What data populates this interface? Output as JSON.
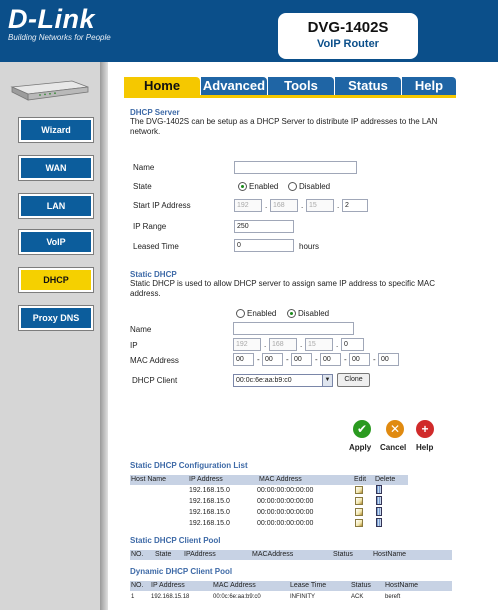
{
  "header": {
    "brand": "D-Link",
    "tagline": "Building Networks for People",
    "product_name": "DVG-1402S",
    "product_sub": "VoIP Router"
  },
  "sidebar": {
    "items": [
      {
        "label": "Wizard",
        "active": false
      },
      {
        "label": "WAN",
        "active": false
      },
      {
        "label": "LAN",
        "active": false
      },
      {
        "label": "VoIP",
        "active": false
      },
      {
        "label": "DHCP",
        "active": true
      },
      {
        "label": "Proxy DNS",
        "active": false
      }
    ]
  },
  "tabs": [
    {
      "label": "Home",
      "active": true
    },
    {
      "label": "Advanced",
      "active": false
    },
    {
      "label": "Tools",
      "active": false
    },
    {
      "label": "Status",
      "active": false
    },
    {
      "label": "Help",
      "active": false
    }
  ],
  "dhcp_server": {
    "title": "DHCP Server",
    "description": "The DVG-1402S can be setup as a DHCP Server to distribute IP addresses to the LAN network.",
    "name_label": "Name",
    "name_value": "",
    "state_label": "State",
    "enabled_label": "Enabled",
    "disabled_label": "Disabled",
    "state_selected": "Enabled",
    "start_ip_label": "Start IP Address",
    "start_ip": [
      "192",
      "168",
      "15",
      "2"
    ],
    "ip_range_label": "IP Range",
    "ip_range_value": "250",
    "lease_label": "Leased Time",
    "lease_value": "0",
    "lease_unit": "hours"
  },
  "static_dhcp": {
    "title": "Static DHCP",
    "description": "Static DHCP is used to allow DHCP server to assign same IP address to specific MAC address.",
    "enabled_label": "Enabled",
    "disabled_label": "Disabled",
    "state_selected": "Disabled",
    "name_label": "Name",
    "name_value": "",
    "ip_label": "IP",
    "ip": [
      "192",
      "168",
      "15",
      "0"
    ],
    "mac_label": "MAC Address",
    "mac": [
      "00",
      "00",
      "00",
      "00",
      "00",
      "00"
    ],
    "client_label": "DHCP Client",
    "client_selected": "00:0c:6e:aa:b9:c0",
    "clone_label": "Clone"
  },
  "actions": {
    "apply_label": "Apply",
    "cancel_label": "Cancel",
    "help_label": "Help",
    "apply_color": "#2a9a1f",
    "cancel_color": "#e08a10",
    "help_color": "#d02a2a"
  },
  "config_list": {
    "title": "Static DHCP Configuration List",
    "columns": [
      "Host Name",
      "IP Address",
      "MAC Address",
      "Edit",
      "Delete"
    ],
    "rows": [
      {
        "host": "",
        "ip": "192.168.15.0",
        "mac": "00:00:00:00:00:00"
      },
      {
        "host": "",
        "ip": "192.168.15.0",
        "mac": "00:00:00:00:00:00"
      },
      {
        "host": "",
        "ip": "192.168.15.0",
        "mac": "00:00:00:00:00:00"
      },
      {
        "host": "",
        "ip": "192.168.15.0",
        "mac": "00:00:00:00:00:00"
      }
    ]
  },
  "static_pool": {
    "title": "Static DHCP Client Pool",
    "columns": [
      "NO.",
      "State",
      "IPAddress",
      "MACAddress",
      "Status",
      "HostName"
    ]
  },
  "dynamic_pool": {
    "title": "Dynamic DHCP Client Pool",
    "columns": [
      "NO.",
      "IP Address",
      "MAC Address",
      "Lease Time",
      "Status",
      "HostName"
    ],
    "rows": [
      {
        "no": "1",
        "ip": "192.168.15.18",
        "mac": "00:0c:6e:aa:b9:c0",
        "lease": "INFINITY",
        "status": "ACK",
        "host": "bereft"
      }
    ]
  }
}
